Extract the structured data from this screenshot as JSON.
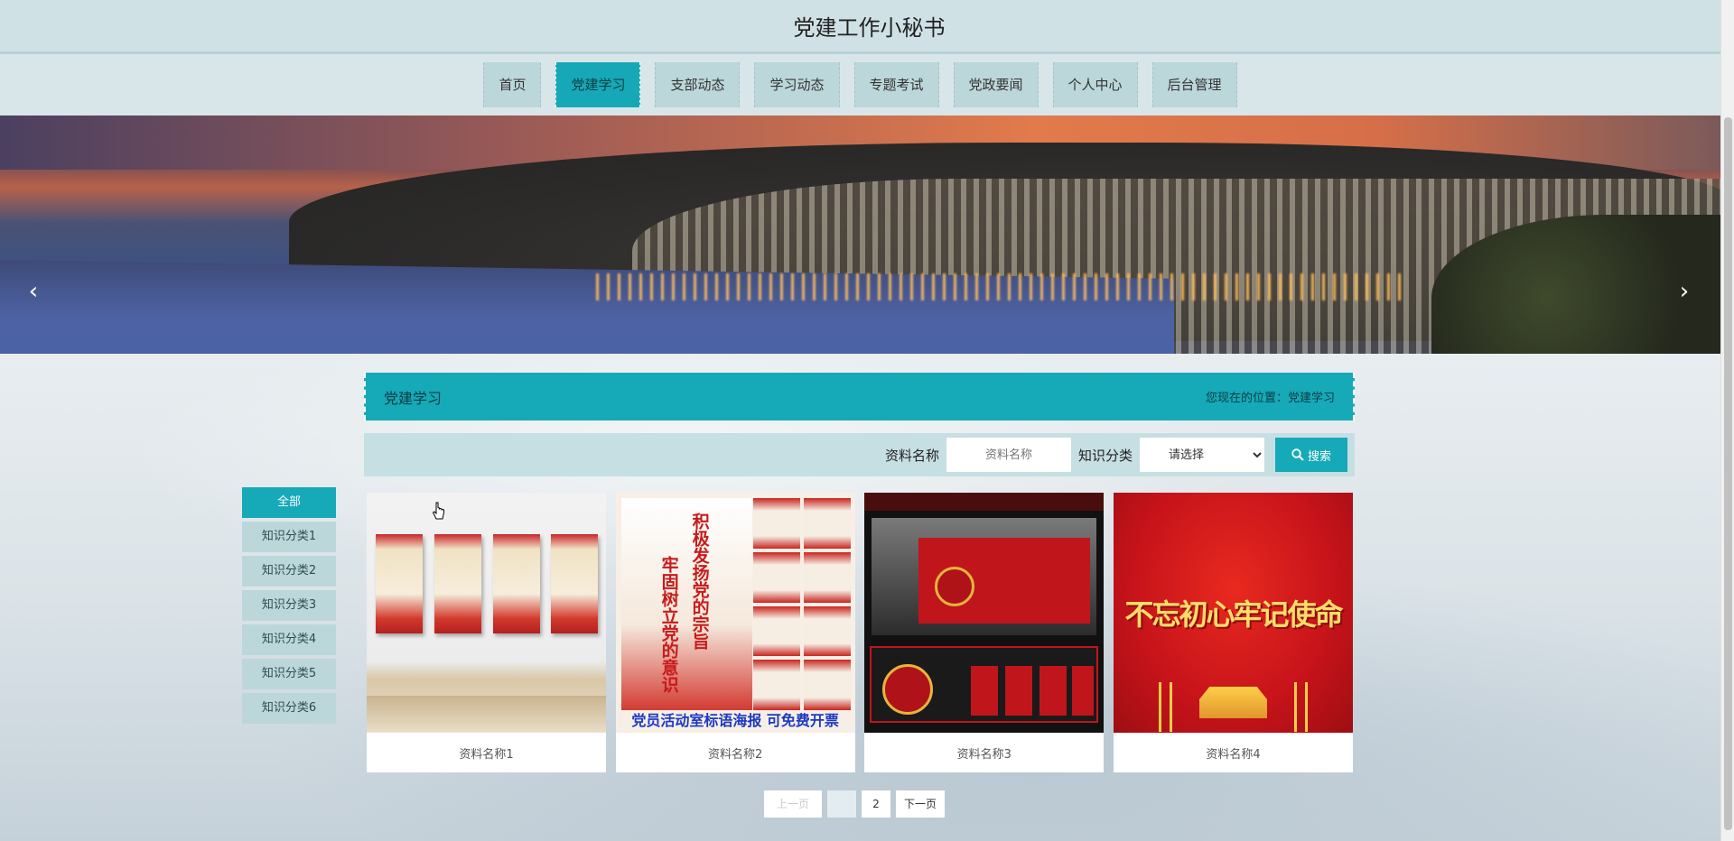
{
  "app": {
    "title": "党建工作小秘书"
  },
  "nav": {
    "items": [
      {
        "label": "首页",
        "active": false
      },
      {
        "label": "党建学习",
        "active": true
      },
      {
        "label": "支部动态",
        "active": false
      },
      {
        "label": "学习动态",
        "active": false
      },
      {
        "label": "专题考试",
        "active": false
      },
      {
        "label": "党政要闻",
        "active": false
      },
      {
        "label": "个人中心",
        "active": false
      },
      {
        "label": "后台管理",
        "active": false
      }
    ]
  },
  "banner": {
    "prev_icon": "chevron-left-icon",
    "next_icon": "chevron-right-icon"
  },
  "section": {
    "title": "党建学习",
    "breadcrumb": "您现在的位置：党建学习"
  },
  "search": {
    "name_label": "资料名称",
    "name_placeholder": "资料名称",
    "name_value": "",
    "category_label": "知识分类",
    "category_selected": "请选择",
    "button_label": "搜索",
    "button_icon": "search-icon"
  },
  "categories": [
    {
      "label": "全部",
      "active": true
    },
    {
      "label": "知识分类1",
      "active": false
    },
    {
      "label": "知识分类2",
      "active": false
    },
    {
      "label": "知识分类3",
      "active": false
    },
    {
      "label": "知识分类4",
      "active": false
    },
    {
      "label": "知识分类5",
      "active": false
    },
    {
      "label": "知识分类6",
      "active": false
    }
  ],
  "cards": [
    {
      "caption": "资料名称1"
    },
    {
      "caption": "资料名称2",
      "poster": {
        "main_text": "积极发扬党的宗旨",
        "sub_text": "牢固树立党的意识",
        "footer": "党员活动室标语海报  可免费开票"
      }
    },
    {
      "caption": "资料名称3"
    },
    {
      "caption": "资料名称4",
      "poster": {
        "slogan": "不忘初心牢记使命"
      }
    }
  ],
  "pager": {
    "prev": "上一页",
    "current": "1",
    "page2": "2",
    "next": "下一页"
  },
  "colors": {
    "accent": "#16a9b8",
    "nav_bg": "#bcd7d9",
    "header_bg": "#cfe1e5"
  }
}
